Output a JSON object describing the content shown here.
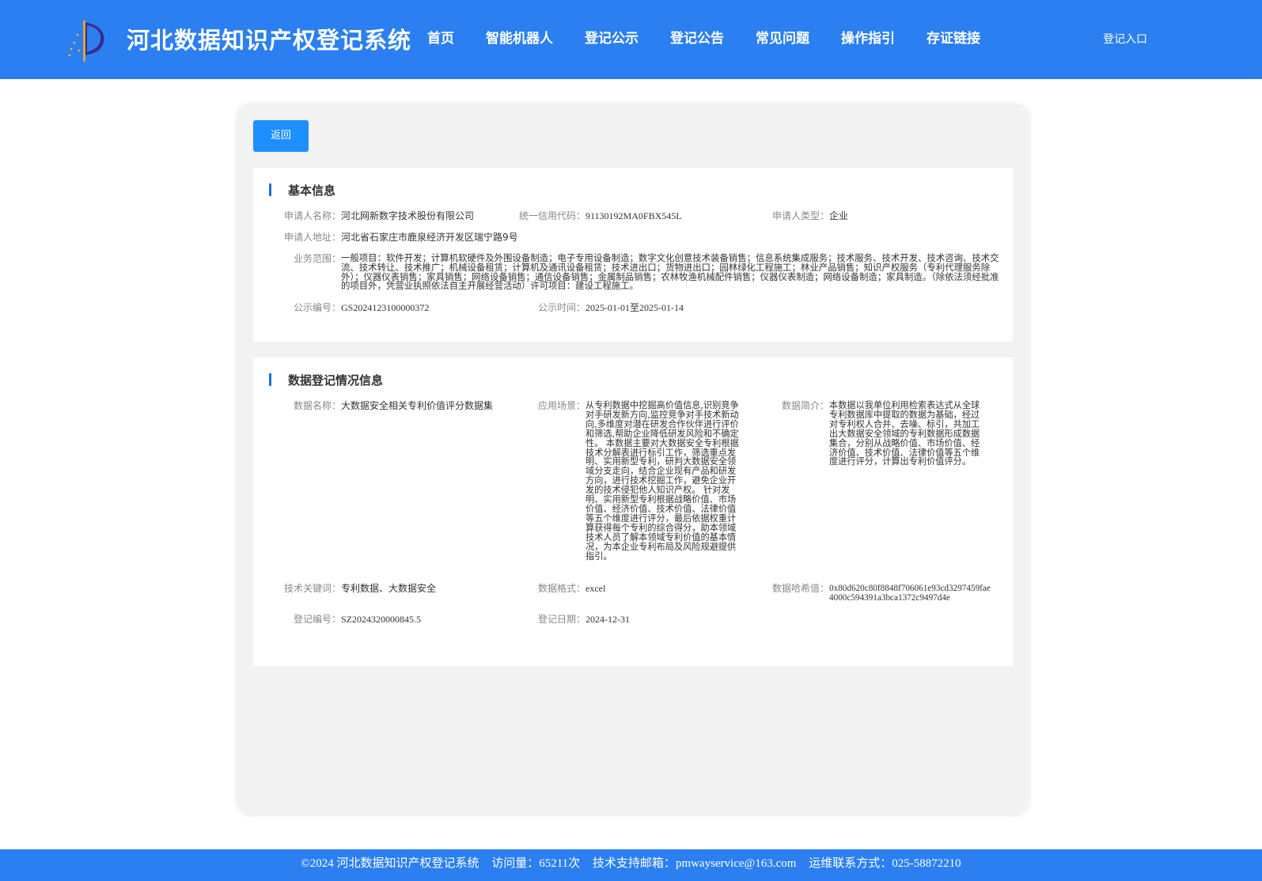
{
  "header": {
    "site_title": "河北数据知识产权登记系统",
    "logo_icon": "sail-logo-icon",
    "nav": [
      "首页",
      "智能机器人",
      "登记公示",
      "登记公告",
      "常见问题",
      "操作指引",
      "存证链接"
    ],
    "login_label": "登记入口"
  },
  "back_label": "返回",
  "basic": {
    "title": "基本信息",
    "applicant_name_label": "申请人名称：",
    "applicant_name": "河北网新数字技术股份有限公司",
    "credit_code_label": "统一信用代码：",
    "credit_code": "91130192MA0FBX545L",
    "applicant_type_label": "申请人类型：",
    "applicant_type": "企业",
    "address_label": "申请人地址：",
    "address": "河北省石家庄市鹿泉经济开发区瑞宁路9号",
    "scope_label": "业务范围：",
    "scope": "一般项目：软件开发；计算机软硬件及外围设备制造；电子专用设备制造；数字文化创意技术装备销售；信息系统集成服务；技术服务、技术开发、技术咨询、技术交流、技术转让、技术推广；机械设备租赁；计算机及通讯设备租赁；技术进出口；货物进出口；园林绿化工程施工；林业产品销售；知识产权服务（专利代理服务除外）；仪器仪表销售；家具销售；网络设备销售；通信设备销售；金属制品销售；农林牧渔机械配件销售；仪器仪表制造；网络设备制造；家具制造。（除依法须经批准的项目外，凭营业执照依法自主开展经营活动）许可项目：建设工程施工。",
    "pub_no_label": "公示编号：",
    "pub_no": "GS2024123100000372",
    "pub_time_label": "公示时间：",
    "pub_time": "2025-01-01至2025-01-14"
  },
  "data_reg": {
    "title": "数据登记情况信息",
    "name_label": "数据名称：",
    "name": "大数据安全相关专利价值评分数据集",
    "scenario_label": "应用场景：",
    "scenario": "从专利数据中挖掘高价值信息,识别竞争对手研发新方向,监控竞争对手技术新动向,多维度对潜在研发合作伙伴进行评价和筛选,帮助企业降低研发风险和不确定性。 本数据主要对大数据安全专利根据技术分解表进行标引工作，筛选重点发明、实用新型专利，研判大数据安全领域分支走向，结合企业现有产品和研发方向，进行技术挖掘工作，避免企业开发的技术侵犯他人知识产权。 针对发明、实用新型专利根据战略价值、市场价值、经济价值、技术价值、法律价值等五个维度进行评分，最后依据权重计算获得每个专利的综合得分，助本领域技术人员了解本领域专利价值的基本情况，为本企业专利布局及风险规避提供指引。",
    "intro_label": "数据简介：",
    "intro": "本数据以我单位利用检索表达式从全球专利数据库中提取的数据为基础，经过对专利权人合并、去噪、标引，共加工出大数据安全领域的专利数据形成数据集合，分别从战略价值、市场价值、经济价值、技术价值、法律价值等五个维度进行评分，计算出专利价值评分。",
    "keywords_label": "技术关键词：",
    "keywords": "专利数据、大数据安全",
    "format_label": "数据格式：",
    "format": "excel",
    "hash_label": "数据哈希值：",
    "hash": "0x80d620c80f8848f706061e93cd3297459fae4000c594391a3bca1372c9497d4e",
    "reg_no_label": "登记编号：",
    "reg_no": "SZ2024320000845.5",
    "reg_date_label": "登记日期：",
    "reg_date": "2024-12-31"
  },
  "footer": {
    "copyright": "©2024 河北数据知识产权登记系统",
    "visits": "访问量：65211次",
    "email": "技术支持邮箱：pmwayservice@163.com",
    "contact": "运维联系方式：025-58872210"
  },
  "colors": {
    "header_bg": "#2b7ff0",
    "button_bg": "#1e8fff",
    "accent_bar": "#1e6fd9",
    "panel_bg": "#f2f2f2"
  }
}
